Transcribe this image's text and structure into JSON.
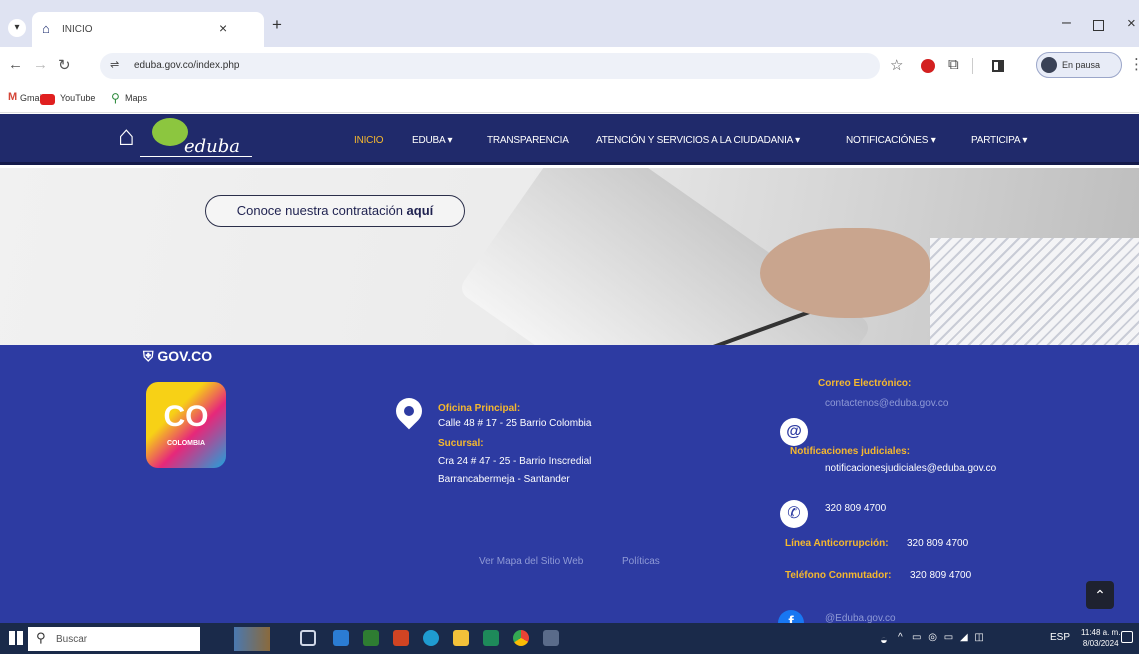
{
  "browser": {
    "tab_title": "INICIO",
    "url": "eduba.gov.co/index.php",
    "profile_label": "En pausa",
    "bookmarks": [
      "Gmail",
      "YouTube",
      "Maps"
    ]
  },
  "site": {
    "logo_text": "eduba",
    "menu": [
      "INICIO",
      "EDUBA ▾",
      "TRANSPARENCIA",
      "ATENCIÓN Y SERVICIOS A LA CIUDADANIA ▾",
      "NOTIFICACIÓNES ▾",
      "PARTICIPA ▾"
    ],
    "hero_cta_text": "Conoce nuestra contratación ",
    "hero_cta_link": "aquí"
  },
  "footer": {
    "govco": "GOV.CO",
    "co_logo": "CO",
    "co_sub": "COLOMBIA",
    "office_label": "Oficina Principal:",
    "office_address": "Calle 48 # 17 - 25 Barrio Colombia",
    "branch_label": "Sucursal:",
    "branch_address_1": "Cra 24 # 47 - 25 - Barrio Inscredial",
    "branch_address_2": "Barrancabermeja - Santander",
    "email_label": "Correo Electrónico:",
    "email_value": "contactenos@eduba.gov.co",
    "notif_label": "Notificaciones judiciales:",
    "notif_value": "notificacionesjudiciales@eduba.gov.co",
    "phone_value": "320 809 4700",
    "anticorrupcion_label": "Línea Anticorrupción:",
    "anticorrupcion_value": "320 809 4700",
    "conmutador_label": "Teléfono Conmutador:",
    "conmutador_value": "320 809 4700",
    "sitemap_link": "Ver Mapa del Sitio Web",
    "policies_link": "Políticas",
    "facebook_handle": "@Eduba.gov.co"
  },
  "taskbar": {
    "search_placeholder": "Buscar",
    "language": "ESP",
    "time": "11:48 a. m.",
    "date": "8/03/2024"
  }
}
